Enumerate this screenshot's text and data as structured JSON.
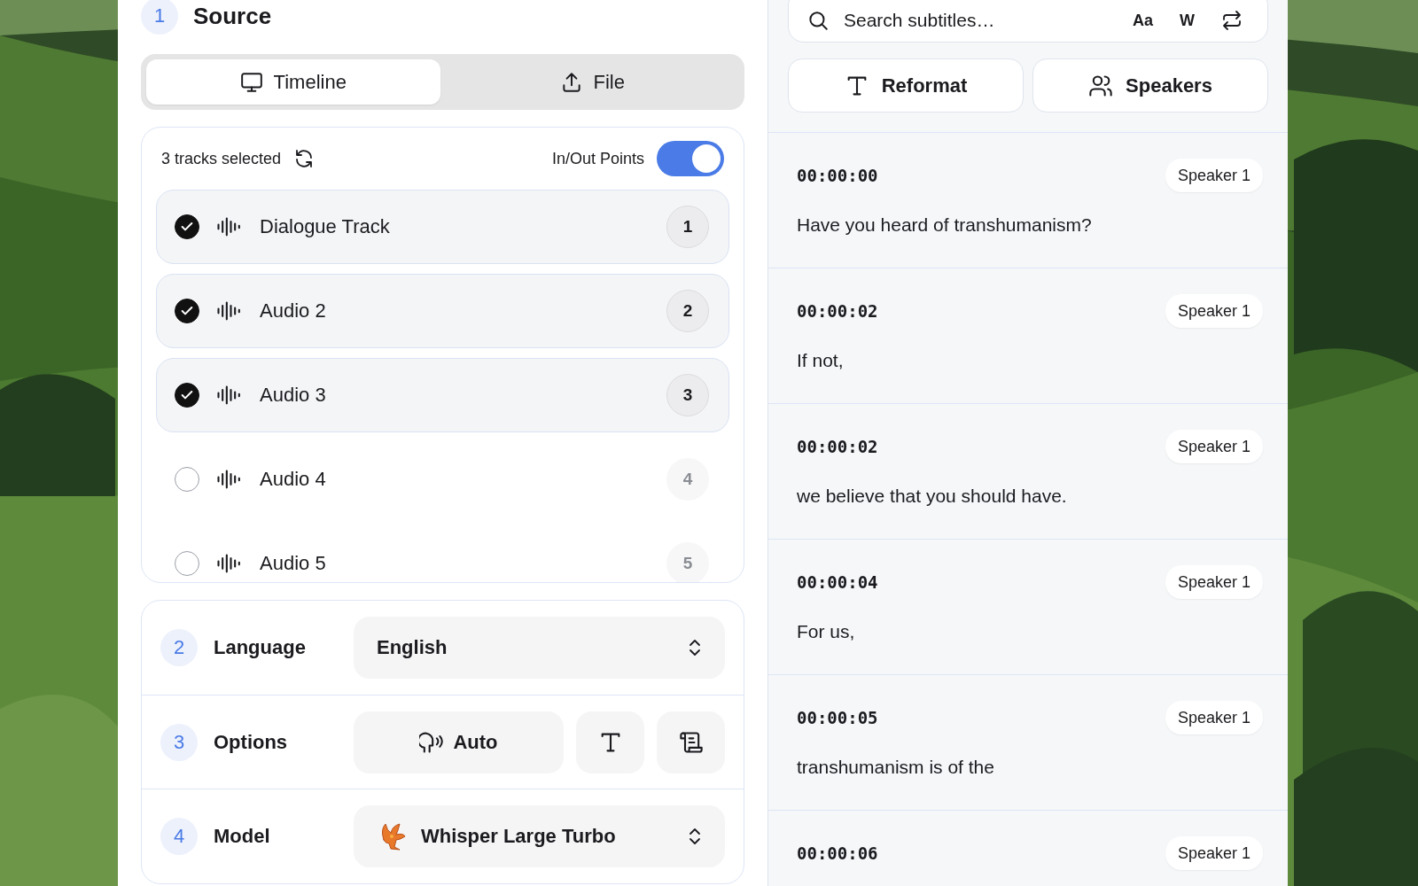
{
  "source": {
    "step": "1",
    "title": "Source"
  },
  "source_tabs": [
    {
      "label": "Timeline",
      "selected": true
    },
    {
      "label": "File",
      "selected": false
    }
  ],
  "tracks": {
    "summary": "3 tracks selected",
    "in_out_points": {
      "label": "In/Out Points",
      "on": true
    },
    "items": [
      {
        "name": "Dialogue Track",
        "number": "1",
        "checked": true
      },
      {
        "name": "Audio 2",
        "number": "2",
        "checked": true
      },
      {
        "name": "Audio 3",
        "number": "3",
        "checked": true
      },
      {
        "name": "Audio 4",
        "number": "4",
        "checked": false
      },
      {
        "name": "Audio 5",
        "number": "5",
        "checked": false
      }
    ]
  },
  "settings": [
    {
      "kind": "select",
      "step": "2",
      "label": "Language",
      "value": "English"
    },
    {
      "kind": "options",
      "step": "3",
      "label": "Options",
      "value": "Auto"
    },
    {
      "kind": "model",
      "step": "4",
      "label": "Model",
      "value": "Whisper Large Turbo"
    }
  ],
  "search": {
    "placeholder": "Search subtitles…",
    "toggles": [
      "Aa",
      "W"
    ]
  },
  "actions": [
    "Reformat",
    "Speakers"
  ],
  "subtitles": [
    {
      "time": "00:00:00",
      "speaker": "Speaker 1",
      "text": "Have you heard of transhumanism?"
    },
    {
      "time": "00:00:02",
      "speaker": "Speaker 1",
      "text": "If not,"
    },
    {
      "time": "00:00:02",
      "speaker": "Speaker 1",
      "text": "we believe that you should have."
    },
    {
      "time": "00:00:04",
      "speaker": "Speaker 1",
      "text": "For us,"
    },
    {
      "time": "00:00:05",
      "speaker": "Speaker 1",
      "text": "transhumanism is of the"
    },
    {
      "time": "00:00:06",
      "speaker": "Speaker 1"
    }
  ]
}
